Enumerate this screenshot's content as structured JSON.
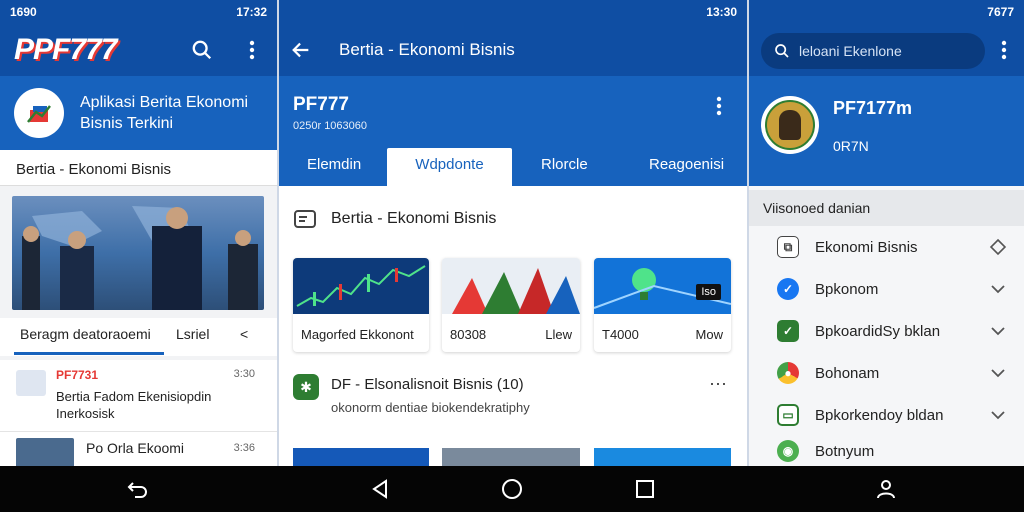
{
  "left": {
    "status": {
      "time": "1690",
      "clock": "17:32"
    },
    "logo": "PPF777",
    "app_title": "Aplikasi Berita Ekonomi Bisnis Terkini",
    "section_title": "Bertia - Ekonomi Bisnis",
    "tabs": [
      "Beragm deatoraoemi",
      "Lsriel",
      "<"
    ],
    "news": [
      {
        "tag": "PF7731",
        "title": "Bertia Fadom Ekenisiopdin Inerkosisk",
        "time": "3:30"
      },
      {
        "tag": "",
        "title": "Po Orla Ekoomi",
        "time": "3:36"
      }
    ]
  },
  "middle": {
    "status": {
      "clock": "13:30"
    },
    "title": "Bertia - Ekonomi Bisnis",
    "brand": "PF777",
    "brand_sub": "0250r 1063060",
    "tabs": [
      "Elemdin",
      "Wdpdonte",
      "Rlorcle",
      "Reagoenisi"
    ],
    "section_title": "Bertia - Ekonomi Bisnis",
    "cards": [
      {
        "label": "Magorfed Ekkonont",
        "right": ""
      },
      {
        "label": "80308",
        "right": "Llew"
      },
      {
        "label": "T4000",
        "right": "Mow",
        "badge": "Iso"
      }
    ],
    "post": {
      "title": "DF - Elsonalisnoit Bisnis (10)",
      "subtitle": "okonorm dentiae biokendekratiphy"
    }
  },
  "right": {
    "status": {
      "clock": "7677"
    },
    "search_placeholder": "leloani Ekenlone",
    "profile_name": "PF7177m",
    "profile_sub": "0R7N",
    "section": "Viisonoed danian",
    "items": [
      {
        "label": "Ekonomi Bisnis",
        "icon": "diamond-icon",
        "color": "#ffffff"
      },
      {
        "label": "Bpkonom",
        "icon": "messenger-icon",
        "color": "#1877f2"
      },
      {
        "label": "BpkoardidSy bklan",
        "icon": "sheet-icon",
        "color": "#2e7d32"
      },
      {
        "label": "Bohonam",
        "icon": "chrome-icon",
        "color": "#e53935"
      },
      {
        "label": "Bpkorkendoy bldan",
        "icon": "chat-icon",
        "color": "#2e7d32"
      },
      {
        "label": "Botnyum",
        "icon": "globe-icon",
        "color": "#4caf50"
      }
    ]
  },
  "colors": {
    "primary": "#1762bd",
    "accent": "#e53935",
    "status": "#0f4ea3"
  }
}
